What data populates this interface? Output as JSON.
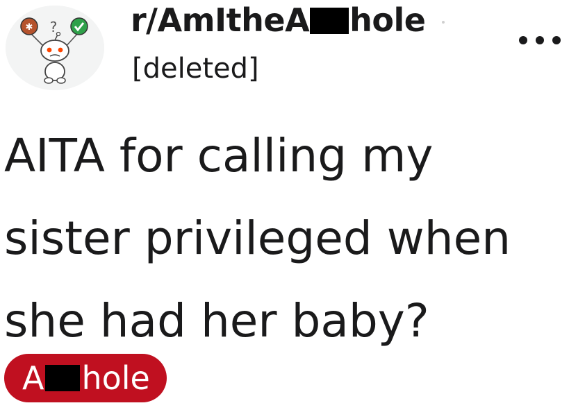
{
  "post": {
    "subreddit_prefix": "r/AmItheA",
    "subreddit_suffix": "hole",
    "author": "[deleted]",
    "title": "AITA for calling my sister privileged when she had her baby?",
    "flair": {
      "prefix": "A",
      "suffix": "hole",
      "background": "#c01020",
      "text_color": "#ffffff"
    },
    "more_icon": "ellipsis-icon",
    "avatar_icon": "reddit-snoo-icon"
  },
  "colors": {
    "text": "#1a1a1b",
    "redaction": "#000000",
    "avatar_bg": "#f3f4f4"
  }
}
